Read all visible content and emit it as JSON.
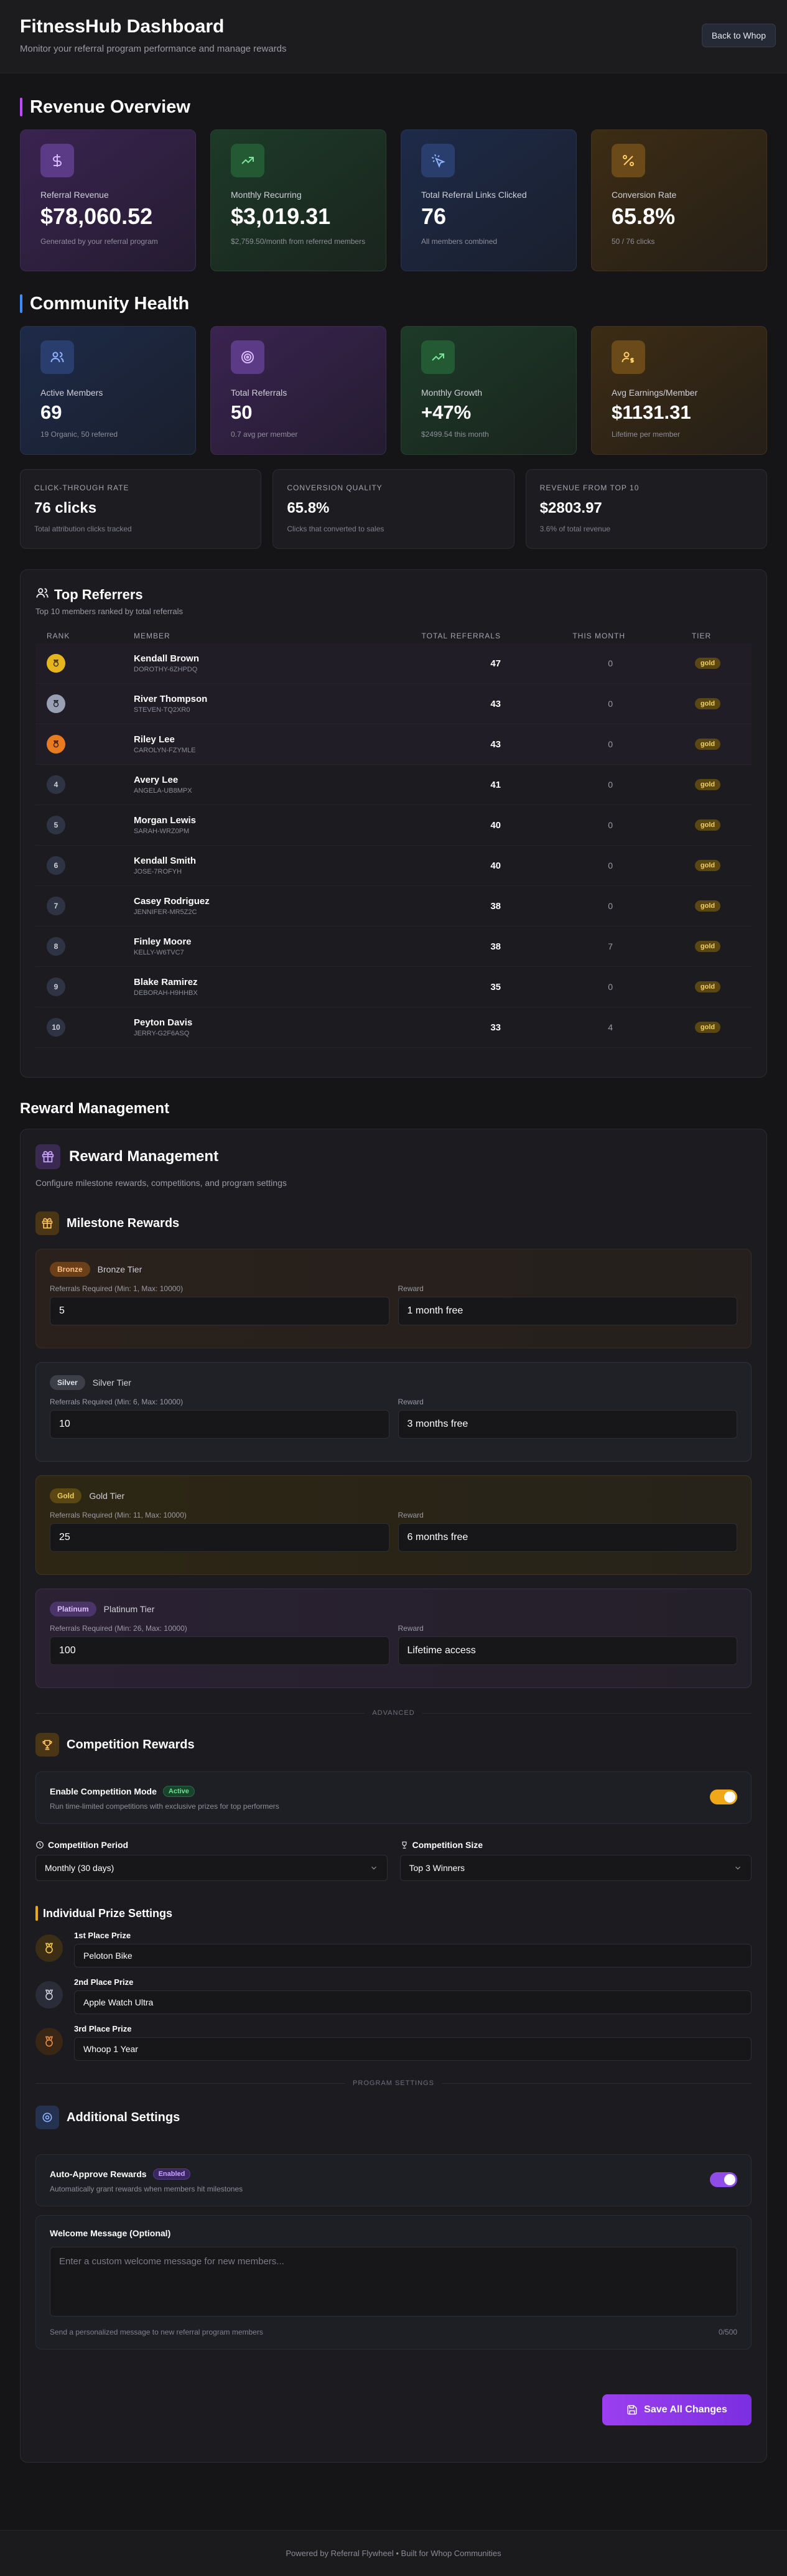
{
  "header": {
    "title": "FitnessHub Dashboard",
    "subtitle": "Monitor your referral program performance and manage rewards",
    "back_label": "Back to Whop"
  },
  "revenue": {
    "title": "Revenue Overview",
    "cards": [
      {
        "label": "Referral Revenue",
        "value": "$78,060.52",
        "note": "Generated by your referral program",
        "icon": "dollar-icon"
      },
      {
        "label": "Monthly Recurring",
        "value": "$3,019.31",
        "note": "$2,759.50/month from referred members",
        "icon": "trend-up-icon"
      },
      {
        "label": "Total Referral Links Clicked",
        "value": "76",
        "note": "All members combined",
        "icon": "cursor-click-icon"
      },
      {
        "label": "Conversion Rate",
        "value": "65.8%",
        "note": "50 / 76 clicks",
        "icon": "percent-icon"
      }
    ]
  },
  "community": {
    "title": "Community Health",
    "cards": [
      {
        "label": "Active Members",
        "value": "69",
        "note": "19 Organic, 50 referred",
        "icon": "users-icon"
      },
      {
        "label": "Total Referrals",
        "value": "50",
        "note": "0.7 avg per member",
        "icon": "target-icon"
      },
      {
        "label": "Monthly Growth",
        "value": "+47%",
        "note": "$2499.54 this month",
        "icon": "trend-up-icon"
      },
      {
        "label": "Avg Earnings/Member",
        "value": "$1131.31",
        "note": "Lifetime per member",
        "icon": "user-dollar-icon"
      }
    ],
    "minis": [
      {
        "label": "CLICK-THROUGH RATE",
        "value": "76 clicks",
        "note": "Total attribution clicks tracked"
      },
      {
        "label": "CONVERSION QUALITY",
        "value": "65.8%",
        "note": "Clicks that converted to sales"
      },
      {
        "label": "REVENUE FROM TOP 10",
        "value": "$2803.97",
        "note": "3.6% of total revenue"
      }
    ]
  },
  "referrers": {
    "title": "Top Referrers",
    "subtitle": "Top 10 members ranked by total referrals",
    "columns": [
      "RANK",
      "MEMBER",
      "TOTAL REFERRALS",
      "THIS MONTH",
      "TIER"
    ],
    "rows": [
      {
        "rank": "",
        "name": "Kendall Brown",
        "code": "DOROTHY-6ZHPDQ",
        "total": "47",
        "month": "0",
        "tier": "gold"
      },
      {
        "rank": "",
        "name": "River Thompson",
        "code": "STEVEN-TQ2XR0",
        "total": "43",
        "month": "0",
        "tier": "gold"
      },
      {
        "rank": "",
        "name": "Riley Lee",
        "code": "CAROLYN-FZYMLE",
        "total": "43",
        "month": "0",
        "tier": "gold"
      },
      {
        "rank": "4",
        "name": "Avery Lee",
        "code": "ANGELA-UB8MPX",
        "total": "41",
        "month": "0",
        "tier": "gold"
      },
      {
        "rank": "5",
        "name": "Morgan Lewis",
        "code": "SARAH-WRZ0PM",
        "total": "40",
        "month": "0",
        "tier": "gold"
      },
      {
        "rank": "6",
        "name": "Kendall Smith",
        "code": "JOSE-7ROFYH",
        "total": "40",
        "month": "0",
        "tier": "gold"
      },
      {
        "rank": "7",
        "name": "Casey Rodriguez",
        "code": "JENNIFER-MR5Z2C",
        "total": "38",
        "month": "0",
        "tier": "gold"
      },
      {
        "rank": "8",
        "name": "Finley Moore",
        "code": "KELLY-W6TVC7",
        "total": "38",
        "month": "7",
        "tier": "gold"
      },
      {
        "rank": "9",
        "name": "Blake Ramirez",
        "code": "DEBORAH-H9HHBX",
        "total": "35",
        "month": "0",
        "tier": "gold"
      },
      {
        "rank": "10",
        "name": "Peyton Davis",
        "code": "JERRY-G2F6ASQ",
        "total": "33",
        "month": "4",
        "tier": "gold"
      }
    ]
  },
  "reward_mgmt": {
    "section_title": "Reward Management",
    "title": "Reward Management",
    "subtitle": "Configure milestone rewards, competitions, and program settings",
    "milestone_title": "Milestone Rewards",
    "reward_label": "Reward",
    "tiers": [
      {
        "pill": "Bronze",
        "name": "Bronze Tier",
        "req_label": "Referrals Required (Min: 1, Max: 10000)",
        "req": "5",
        "reward": "1 month free"
      },
      {
        "pill": "Silver",
        "name": "Silver Tier",
        "req_label": "Referrals Required (Min: 6, Max: 10000)",
        "req": "10",
        "reward": "3 months free"
      },
      {
        "pill": "Gold",
        "name": "Gold Tier",
        "req_label": "Referrals Required (Min: 11, Max: 10000)",
        "req": "25",
        "reward": "6 months free"
      },
      {
        "pill": "Platinum",
        "name": "Platinum Tier",
        "req_label": "Referrals Required (Min: 26, Max: 10000)",
        "req": "100",
        "reward": "Lifetime access"
      }
    ],
    "advanced_label": "ADVANCED",
    "competition_title": "Competition Rewards",
    "competition_mode_label": "Enable Competition Mode",
    "competition_mode_badge": "Active",
    "competition_mode_desc": "Run time-limited competitions with exclusive prizes for top performers",
    "period_label": "Competition Period",
    "period_value": "Monthly (30 days)",
    "size_label": "Competition Size",
    "size_value": "Top 3 Winners",
    "prize_title": "Individual Prize Settings",
    "prizes": [
      {
        "label": "1st Place Prize",
        "value": "Peloton Bike"
      },
      {
        "label": "2nd Place Prize",
        "value": "Apple Watch Ultra"
      },
      {
        "label": "3rd Place Prize",
        "value": "Whoop 1 Year"
      }
    ],
    "program_settings_label": "PROGRAM SETTINGS",
    "additional_title": "Additional Settings",
    "auto_label": "Auto-Approve Rewards",
    "auto_badge": "Enabled",
    "auto_desc": "Automatically grant rewards when members hit milestones",
    "welcome_label": "Welcome Message (Optional)",
    "welcome_placeholder": "Enter a custom welcome message for new members...",
    "welcome_help": "Send a personalized message to new referral program members",
    "welcome_count": "0/500",
    "save_label": "Save All Changes"
  },
  "footer": {
    "text": "Powered by Referral Flywheel • Built for Whop Communities"
  },
  "colors": {
    "accent_purple": "#9b3ff0",
    "gold": "#f3cf5e",
    "background": "#151517"
  }
}
